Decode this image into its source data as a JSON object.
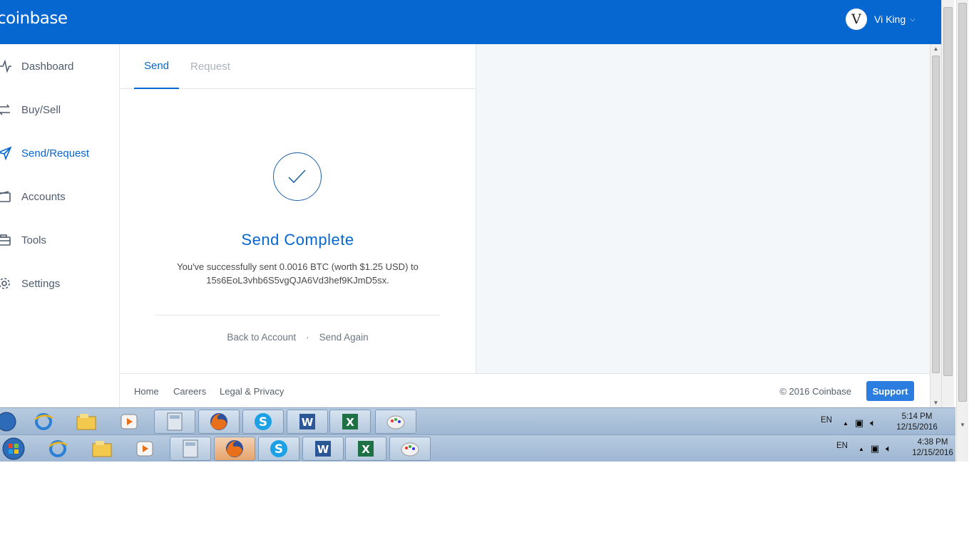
{
  "header": {
    "brand": "coinbase",
    "avatar_letter": "V",
    "user_name": "Vi King",
    "caret": "⌵"
  },
  "sidebar": {
    "items": [
      {
        "label": "Dashboard",
        "icon": "activity-icon"
      },
      {
        "label": "Buy/Sell",
        "icon": "exchange-icon"
      },
      {
        "label": "Send/Request",
        "icon": "send-icon",
        "active": true
      },
      {
        "label": "Accounts",
        "icon": "wallet-icon"
      },
      {
        "label": "Tools",
        "icon": "briefcase-icon"
      },
      {
        "label": "Settings",
        "icon": "gear-icon"
      }
    ]
  },
  "tabs": {
    "send": "Send",
    "request": "Request"
  },
  "result": {
    "title": "Send Complete",
    "line1": "You've successfully sent 0.0016 BTC (worth $1.25 USD) to",
    "line2": "15s6EoL3vhb6S5vgQJA6Vd3hef9KJmD5sx.",
    "back_link": "Back to Account",
    "separator": "·",
    "again_link": "Send Again"
  },
  "footer": {
    "home": "Home",
    "careers": "Careers",
    "legal": "Legal & Privacy",
    "copyright": "© 2016 Coinbase",
    "support": "Support"
  },
  "taskbar_top": {
    "lang": "EN",
    "time": "5:14 PM",
    "date": "12/15/2016"
  },
  "taskbar_bottom": {
    "lang": "EN",
    "time": "4:38 PM",
    "date": "12/15/2016"
  },
  "colors": {
    "brand_blue": "#0667d0",
    "panel_bg": "#f4f7fa",
    "support_blue": "#2b7de0"
  }
}
